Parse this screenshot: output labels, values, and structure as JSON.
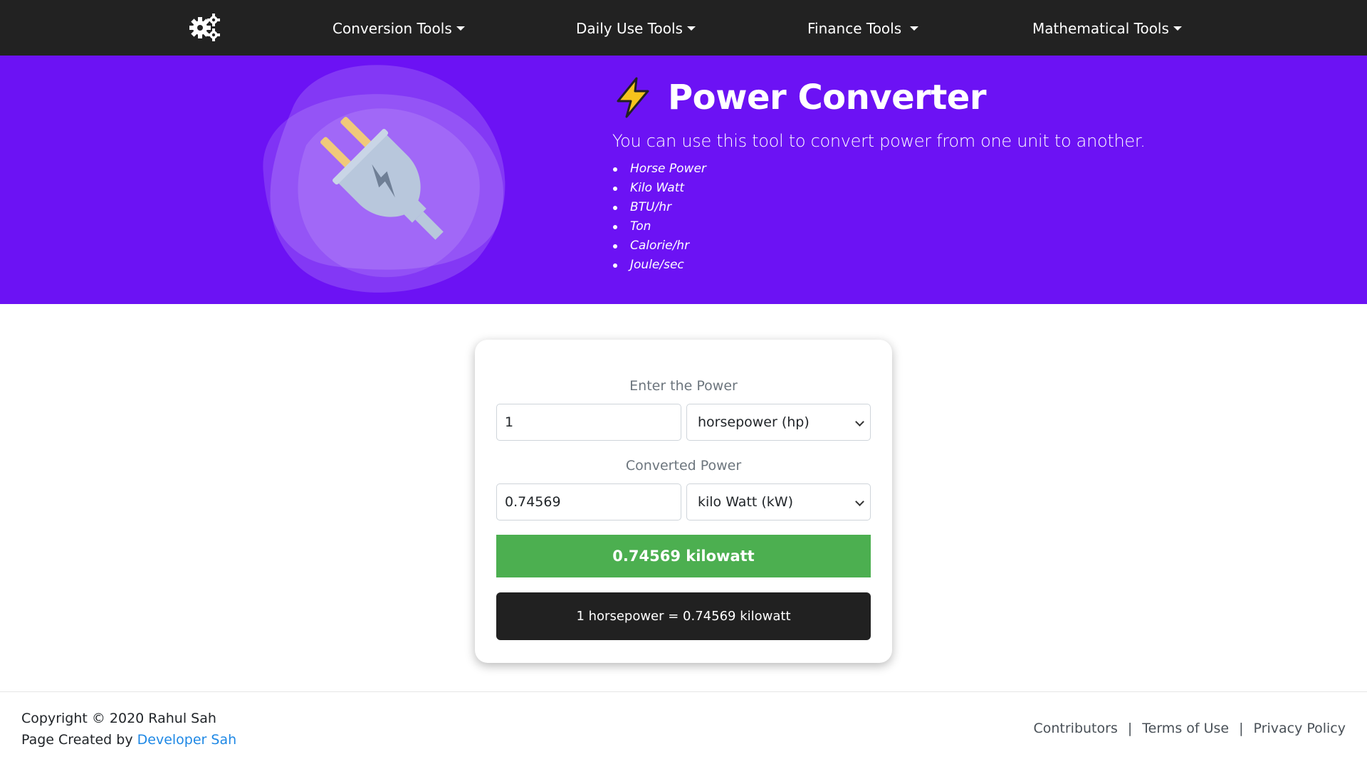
{
  "nav": {
    "brand_icon": "gears-icon",
    "items": [
      {
        "label": "Conversion Tools"
      },
      {
        "label": "Daily Use Tools"
      },
      {
        "label": "Finance Tools"
      },
      {
        "label": "Mathematical Tools"
      }
    ]
  },
  "hero": {
    "icon": "plug-icon",
    "title_icon": "lightning-bolt-icon",
    "title": "Power Converter",
    "subtitle": "You can use this tool to convert power from one unit to another.",
    "units": [
      "Horse Power",
      "Kilo Watt",
      "BTU/hr",
      "Ton",
      "Calorie/hr",
      "Joule/sec"
    ],
    "background_color": "#6c12f4"
  },
  "converter": {
    "input_label": "Enter the Power",
    "input_value": "1",
    "input_unit": "horsepower (hp)",
    "output_label": "Converted Power",
    "output_value": "0.74569",
    "output_unit": "kilo Watt (kW)",
    "result": "0.74569 kilowatt",
    "summary": "1 horsepower = 0.74569 kilowatt",
    "result_color": "#4caf50"
  },
  "footer": {
    "copyright": "Copyright © 2020 Rahul Sah",
    "created_prefix": "Page Created by",
    "created_link": "Developer Sah",
    "links": [
      "Contributors",
      "Terms of Use",
      "Privacy Policy"
    ],
    "separator": "|"
  }
}
